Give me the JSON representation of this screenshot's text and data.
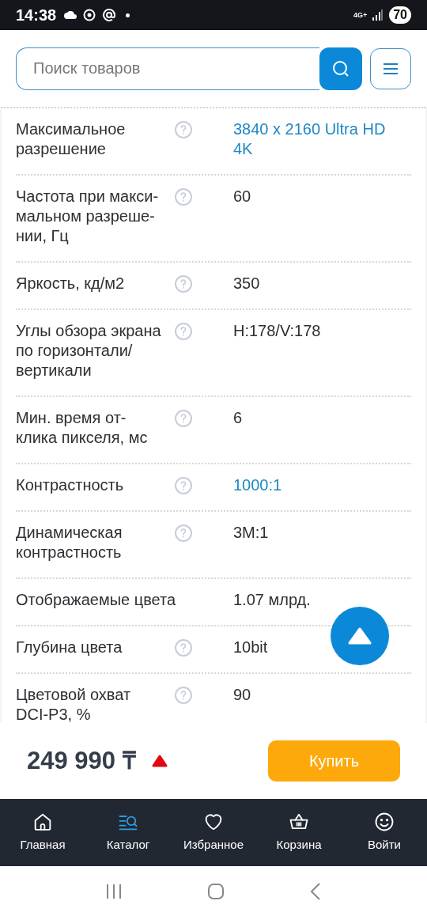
{
  "status_bar": {
    "time": "14:38",
    "network": "4G+",
    "battery": "70"
  },
  "search": {
    "placeholder": "Поиск товаров"
  },
  "specs": [
    {
      "label": "Максимальное разрешение",
      "help": true,
      "value": "3840 x 2160 Ultra HD 4K",
      "link": true
    },
    {
      "label": "Частота при макси-мальном разреше-нии, Гц",
      "help": true,
      "value": "60",
      "link": false
    },
    {
      "label": "Яркость, кд/м2",
      "help": true,
      "value": "350",
      "link": false
    },
    {
      "label": "Углы обзора экрана по горизонтали/ вертикали",
      "help": true,
      "value": "H:178/V:178",
      "link": false
    },
    {
      "label": "Мин. время от-клика пикселя, мс",
      "help": true,
      "value": "6",
      "link": false
    },
    {
      "label": "Контрастность",
      "help": true,
      "value": "1000:1",
      "link": true
    },
    {
      "label": "Динамическая контрастность",
      "help": true,
      "value": "3M:1",
      "link": false
    },
    {
      "label": "Отображаемые цвета",
      "help": false,
      "value": "1.07 млрд.",
      "link": false
    },
    {
      "label": "Глубина цвета",
      "help": true,
      "value": "10bit",
      "link": false
    },
    {
      "label": "Цветовой охват DCI-P3, %",
      "help": true,
      "value": "90",
      "link": false
    }
  ],
  "price": "249 990 ₸",
  "buy_button": "Купить",
  "nav": [
    {
      "kind": "home",
      "label": "Главная",
      "selected": false
    },
    {
      "kind": "catalog",
      "label": "Каталог",
      "selected": true
    },
    {
      "kind": "favorites",
      "label": "Избранное",
      "selected": false
    },
    {
      "kind": "cart",
      "label": "Корзина",
      "selected": false
    },
    {
      "kind": "login",
      "label": "Войти",
      "selected": false
    }
  ]
}
